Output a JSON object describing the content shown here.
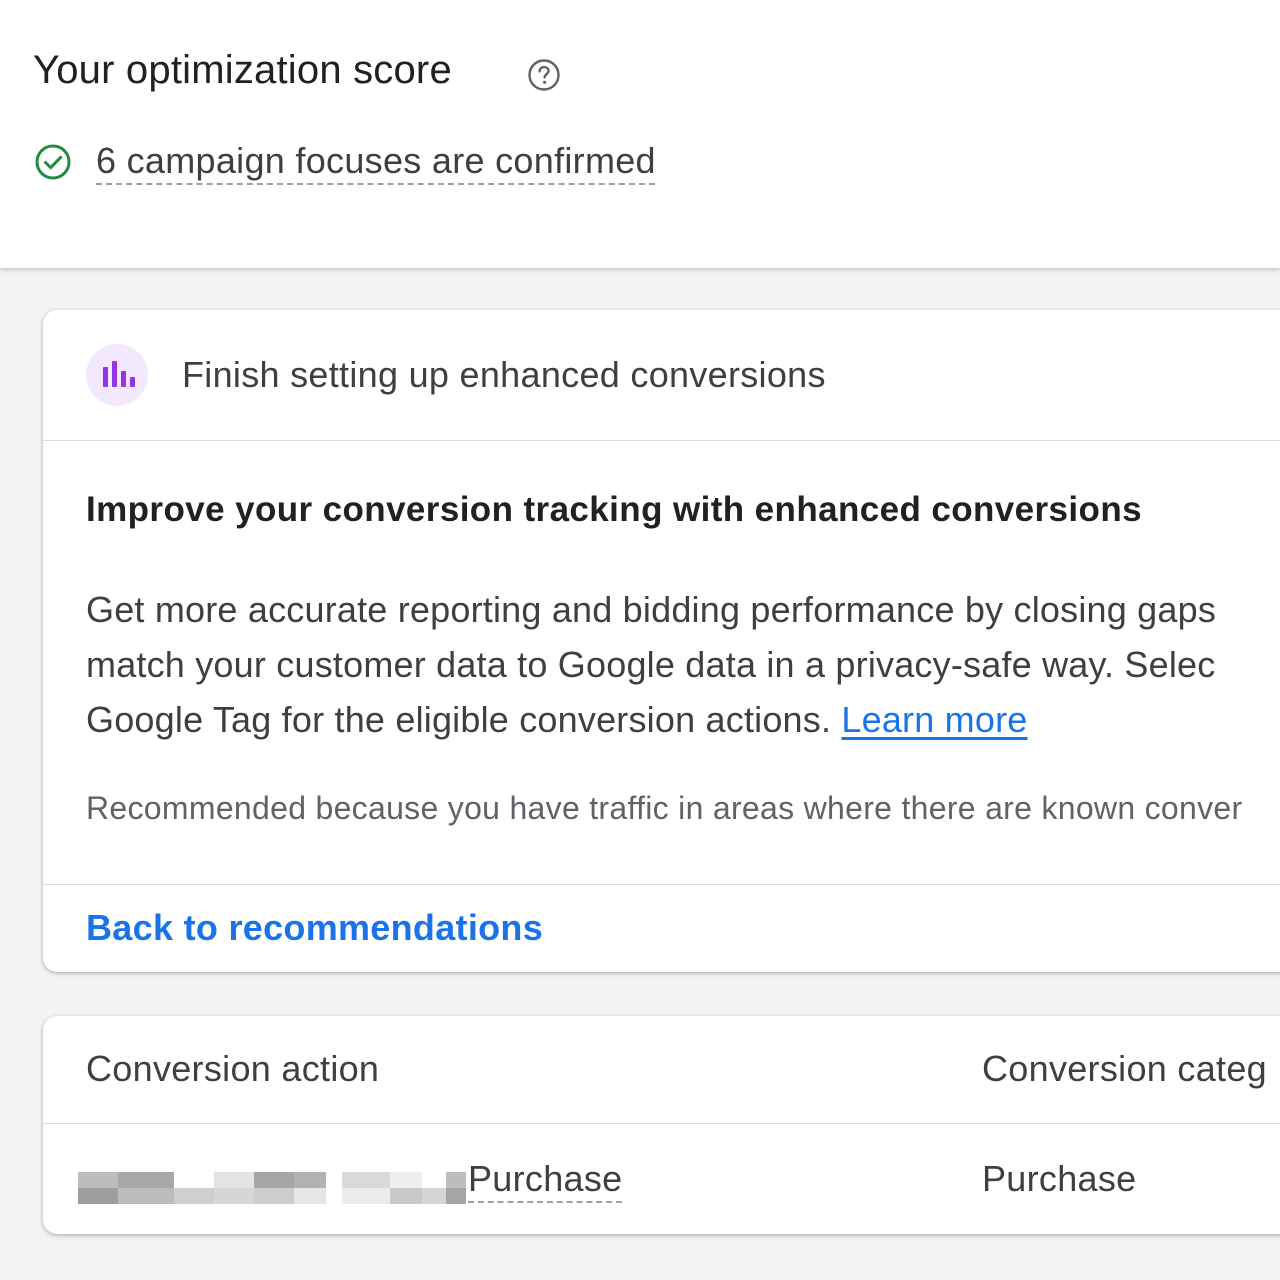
{
  "score_panel": {
    "title": "Your optimization score",
    "help_icon": "help-circle-icon",
    "status_icon": "check-circle-icon",
    "focus_text": "6 campaign focuses are confirmed"
  },
  "recommendation": {
    "icon": "bar-chart-icon",
    "header_title": "Finish setting up enhanced conversions",
    "heading": "Improve your conversion tracking with enhanced conversions",
    "body_lines": [
      "Get more accurate reporting and bidding performance by closing gaps",
      "match your customer data to Google data in a privacy-safe way. Selec",
      "Google Tag for the eligible conversion actions. "
    ],
    "learn_more_label": "Learn more",
    "reason_text": "Recommended because you have traffic in areas where there are known conver",
    "back_label": "Back to recommendations"
  },
  "table": {
    "columns": [
      "Conversion action",
      "Conversion categ"
    ],
    "rows": [
      {
        "action": "Purchase",
        "category": "Purchase"
      }
    ]
  },
  "colors": {
    "accent": "#1a73e8",
    "success": "#1e8e3e",
    "icon_purple": "#9334e6",
    "icon_bg": "#f3e8fd"
  }
}
